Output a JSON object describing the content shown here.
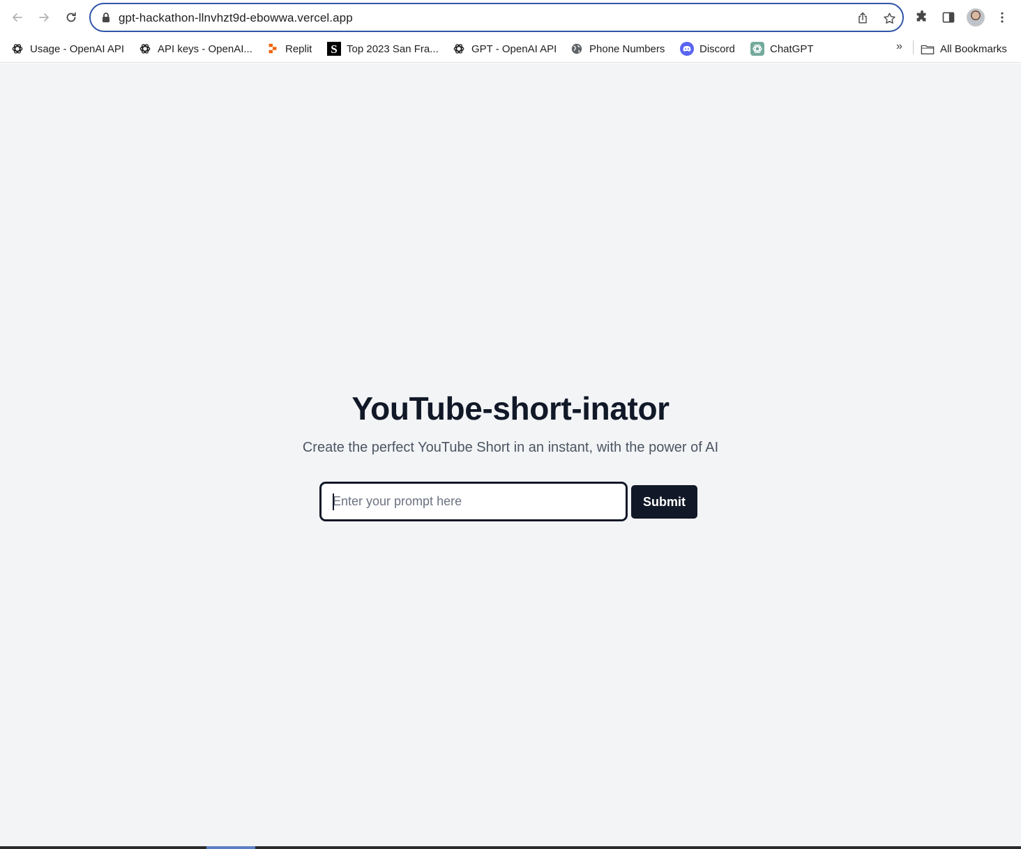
{
  "browser": {
    "url": "gpt-hackathon-llnvhzt9d-ebowwa.vercel.app",
    "bookmarks": [
      {
        "label": "Usage - OpenAI API",
        "icon": "openai-icon"
      },
      {
        "label": "API keys - OpenAI...",
        "icon": "openai-icon"
      },
      {
        "label": "Replit",
        "icon": "replit-icon"
      },
      {
        "label": "Top 2023 San Fra...",
        "icon": "s-logo-icon"
      },
      {
        "label": "GPT - OpenAI API",
        "icon": "openai-icon"
      },
      {
        "label": "Phone Numbers",
        "icon": "globe-icon"
      },
      {
        "label": "Discord",
        "icon": "discord-icon"
      },
      {
        "label": "ChatGPT",
        "icon": "chatgpt-icon"
      }
    ],
    "more_bookmarks": "»",
    "all_bookmarks": "All Bookmarks"
  },
  "page": {
    "title": "YouTube-short-inator",
    "subtitle": "Create the perfect YouTube Short in an instant, with the power of AI",
    "prompt_placeholder": "Enter your prompt here",
    "prompt_value": "",
    "submit_label": "Submit"
  },
  "colors": {
    "page_background": "#f3f4f6",
    "primary": "#111827",
    "subtitle_text": "#4b5563",
    "omnibox_border": "#2f55a8"
  }
}
